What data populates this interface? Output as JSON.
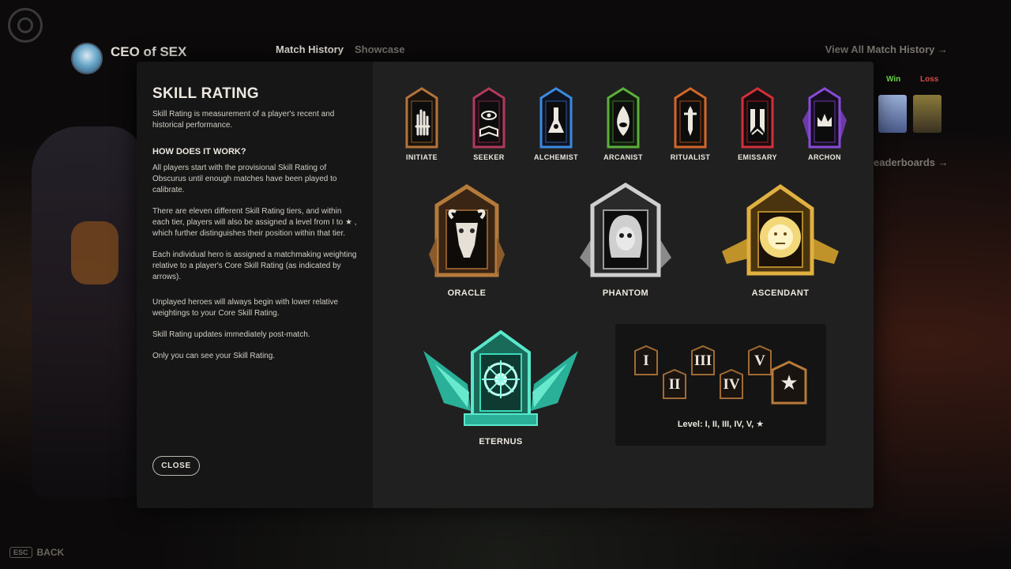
{
  "player": {
    "name": "CEO of SEX"
  },
  "tabs": [
    {
      "label": "Match History",
      "active": true
    },
    {
      "label": "Showcase",
      "active": false
    }
  ],
  "match_history": {
    "view_all_label": "View All Match History",
    "results": [
      "Win",
      "Loss"
    ],
    "leaderboards_label": "eaderboards"
  },
  "footer": {
    "esc_key": "ESC",
    "back_label": "BACK"
  },
  "modal": {
    "title": "SKILL RATING",
    "intro": "Skill Rating is measurement of a player's recent and historical performance.",
    "how_heading": "HOW DOES IT WORK?",
    "paragraphs": [
      "All players start with the provisional Skill Rating of Obscurus until enough matches have been played to calibrate.",
      "There are eleven different Skill Rating tiers, and within each tier, players will also be assigned a level from I to ★ , which further distinguishes their position within that tier.",
      "Each individual hero is assigned a matchmaking weighting relative to a player's Core Skill Rating (as indicated by arrows).",
      "Unplayed heroes will always begin with lower relative weightings to your Core Skill Rating.",
      "Skill Rating updates immediately post-match.",
      "Only you can see your Skill Rating."
    ],
    "close_label": "Close"
  },
  "tiers_small": [
    {
      "name": "INITIATE",
      "color": "#b3733a",
      "icon": "hand-icon"
    },
    {
      "name": "SEEKER",
      "color": "#b03a5a",
      "icon": "eye-book-icon"
    },
    {
      "name": "ALCHEMIST",
      "color": "#3a8ae0",
      "icon": "flask-icon"
    },
    {
      "name": "ARCANIST",
      "color": "#5ab03a",
      "icon": "fire-eye-icon"
    },
    {
      "name": "RITUALIST",
      "color": "#d0682a",
      "icon": "dagger-icon"
    },
    {
      "name": "EMISSARY",
      "color": "#d0303a",
      "icon": "hands-icon"
    },
    {
      "name": "ARCHON",
      "color": "#8a4ad8",
      "icon": "crown-icon"
    }
  ],
  "tiers_big": [
    {
      "name": "ORACLE",
      "color": "#b37a3a",
      "icon": "goat-icon"
    },
    {
      "name": "PHANTOM",
      "color": "#bdbdbd",
      "icon": "skull-icon"
    },
    {
      "name": "ASCENDANT",
      "color": "#e0b040",
      "icon": "sun-face-icon"
    }
  ],
  "tier_top": {
    "name": "ETERNUS",
    "color": "#3ad8b8",
    "icon": "crystal-icon"
  },
  "levels": {
    "items": [
      "I",
      "II",
      "III",
      "IV",
      "V",
      "★"
    ],
    "caption": "Level: I, II, III, IV, V,",
    "caption_star": "★"
  }
}
